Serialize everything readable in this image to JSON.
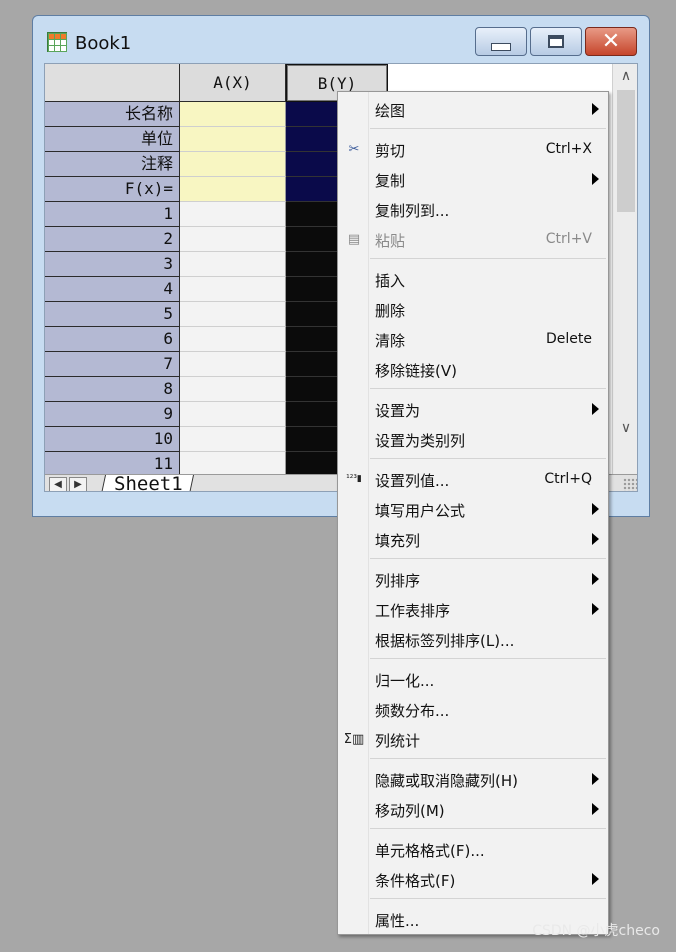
{
  "window": {
    "title": "Book1",
    "close_glyph": "✕"
  },
  "grid": {
    "columns": [
      {
        "label": "A(X)"
      },
      {
        "label": "B(Y)"
      }
    ],
    "meta_rows": [
      "长名称",
      "单位",
      "注释",
      "F(x)="
    ],
    "data_rows": [
      "1",
      "2",
      "3",
      "4",
      "5",
      "6",
      "7",
      "8",
      "9",
      "10",
      "11"
    ],
    "sheet_tab": "Sheet1"
  },
  "menu": {
    "items": [
      {
        "label": "绘图",
        "shortcut": "",
        "submenu": true,
        "icon": ""
      },
      {
        "label": "剪切",
        "shortcut": "Ctrl+X",
        "submenu": false,
        "icon": "scissors-icon"
      },
      {
        "label": "复制",
        "shortcut": "",
        "submenu": true,
        "icon": ""
      },
      {
        "label": "复制列到...",
        "shortcut": "",
        "submenu": false,
        "icon": ""
      },
      {
        "label": "粘贴",
        "shortcut": "Ctrl+V",
        "submenu": false,
        "icon": "paste-icon",
        "disabled": true
      },
      {
        "label": "插入",
        "shortcut": "",
        "submenu": false,
        "icon": ""
      },
      {
        "label": "删除",
        "shortcut": "",
        "submenu": false,
        "icon": ""
      },
      {
        "label": "清除",
        "shortcut": "Delete",
        "submenu": false,
        "icon": ""
      },
      {
        "label": "移除链接(V)",
        "shortcut": "",
        "submenu": false,
        "icon": ""
      },
      {
        "label": "设置为",
        "shortcut": "",
        "submenu": true,
        "icon": ""
      },
      {
        "label": "设置为类别列",
        "shortcut": "",
        "submenu": false,
        "icon": ""
      },
      {
        "label": "设置列值...",
        "shortcut": "Ctrl+Q",
        "submenu": false,
        "icon": "set-column-values-icon"
      },
      {
        "label": "填写用户公式",
        "shortcut": "",
        "submenu": true,
        "icon": ""
      },
      {
        "label": "填充列",
        "shortcut": "",
        "submenu": true,
        "icon": ""
      },
      {
        "label": "列排序",
        "shortcut": "",
        "submenu": true,
        "icon": ""
      },
      {
        "label": "工作表排序",
        "shortcut": "",
        "submenu": true,
        "icon": ""
      },
      {
        "label": "根据标签列排序(L)...",
        "shortcut": "",
        "submenu": false,
        "icon": ""
      },
      {
        "label": "归一化...",
        "shortcut": "",
        "submenu": false,
        "icon": ""
      },
      {
        "label": "频数分布...",
        "shortcut": "",
        "submenu": false,
        "icon": ""
      },
      {
        "label": "列统计",
        "shortcut": "",
        "submenu": false,
        "icon": "sigma-statistics-icon"
      },
      {
        "label": "隐藏或取消隐藏列(H)",
        "shortcut": "",
        "submenu": true,
        "icon": ""
      },
      {
        "label": "移动列(M)",
        "shortcut": "",
        "submenu": true,
        "icon": ""
      },
      {
        "label": "单元格格式(F)...",
        "shortcut": "",
        "submenu": false,
        "icon": ""
      },
      {
        "label": "条件格式(F)",
        "shortcut": "",
        "submenu": true,
        "icon": ""
      },
      {
        "label": "属性...",
        "shortcut": "",
        "submenu": false,
        "icon": ""
      }
    ]
  },
  "watermark": "CSDN @小虎checo"
}
